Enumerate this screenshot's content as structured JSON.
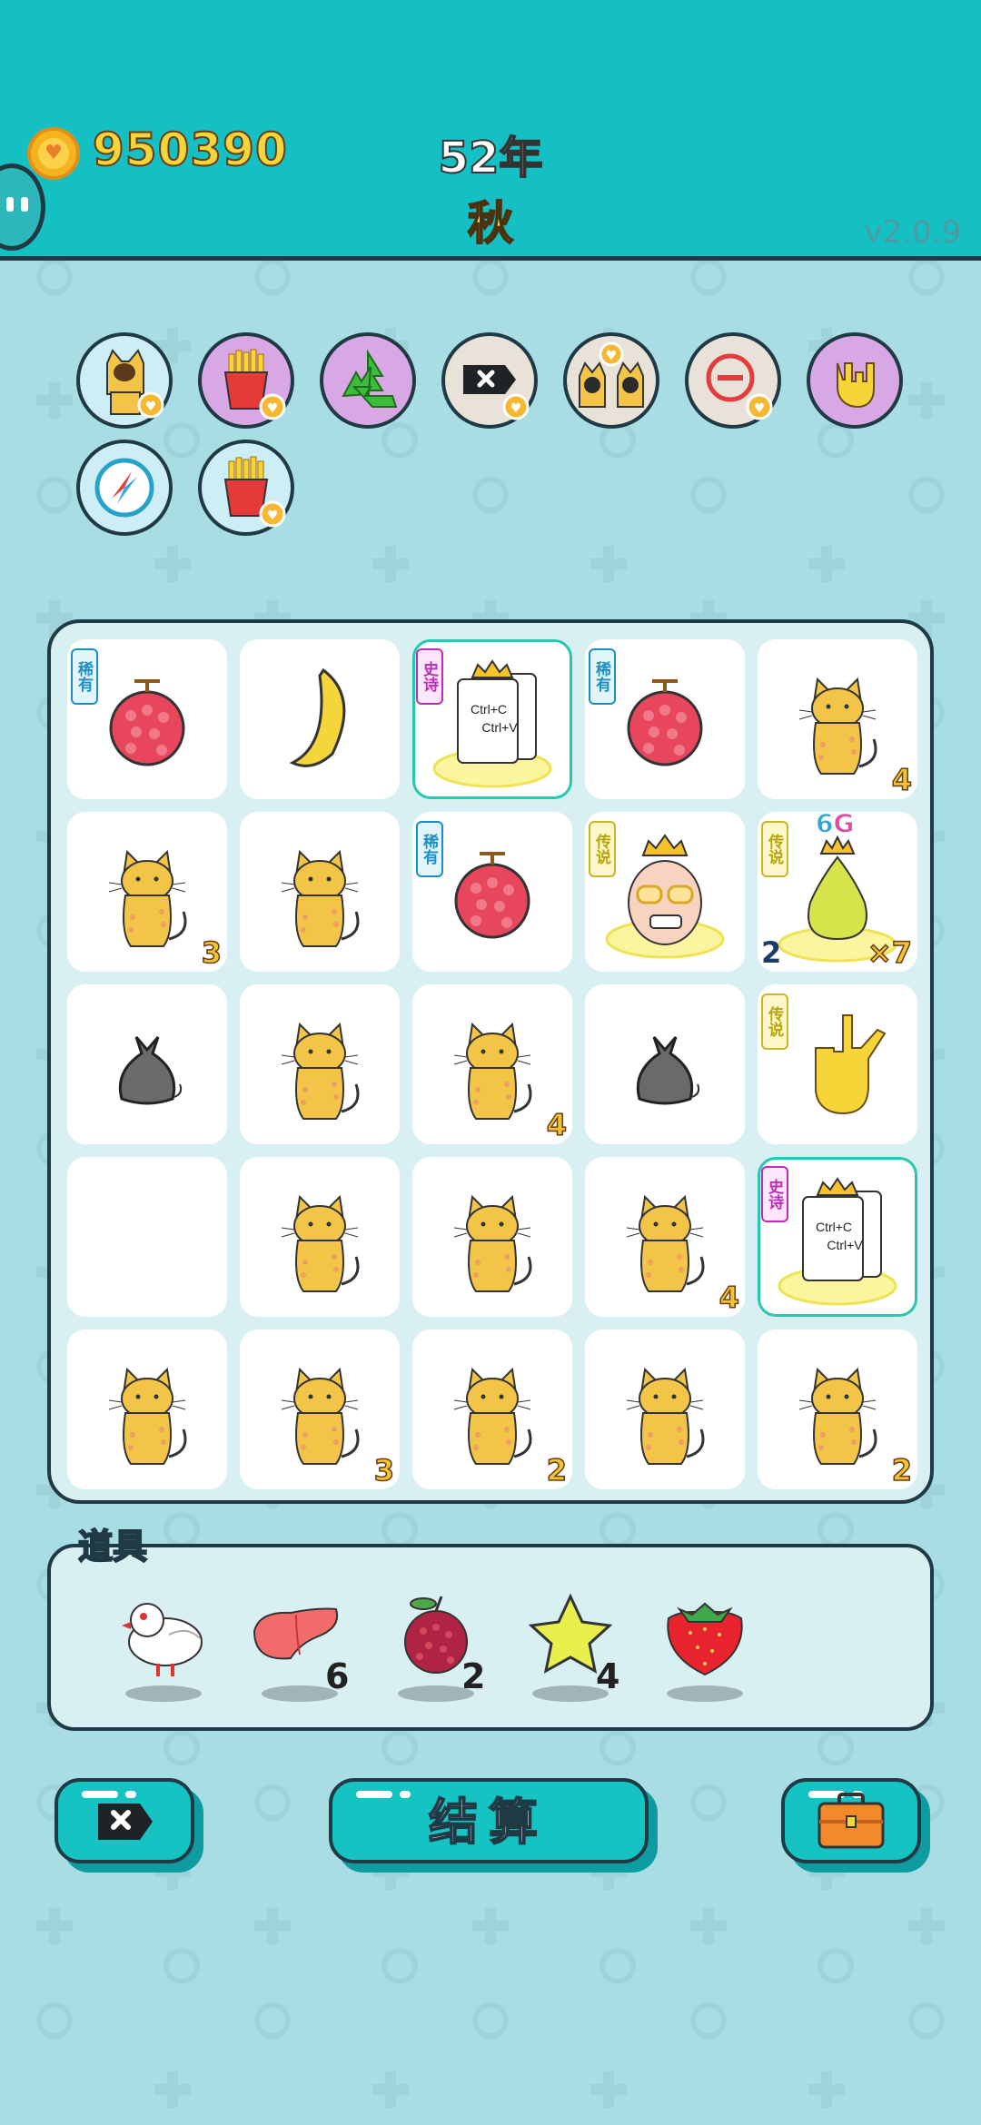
{
  "header": {
    "coins": "950390",
    "year": "52年",
    "season": "秋",
    "version": "v2.0.9"
  },
  "perks": [
    "cat-eating-icon",
    "fries-icon",
    "recycle-icon",
    "remove-tag-icon",
    "cat-glasses-icon",
    "minus-circle-icon",
    "rock-hand-icon",
    "compass-icon",
    "fries-icon"
  ],
  "board": {
    "rows": [
      [
        {
          "symbol": "lychee",
          "tag": "稀有",
          "tag_type": "rare"
        },
        {
          "symbol": "banana"
        },
        {
          "symbol": "ctrl-cv",
          "tag": "史诗",
          "tag_type": "epic",
          "highlight": true
        },
        {
          "symbol": "lychee",
          "tag": "稀有",
          "tag_type": "rare"
        },
        {
          "symbol": "cat",
          "count": "4"
        }
      ],
      [
        {
          "symbol": "cat",
          "count": "3"
        },
        {
          "symbol": "cat"
        },
        {
          "symbol": "lychee",
          "tag": "稀有",
          "tag_type": "rare"
        },
        {
          "symbol": "bald-king",
          "tag": "传说",
          "tag_type": "legend"
        },
        {
          "symbol": "pear-king",
          "tag": "传说",
          "tag_type": "legend",
          "count": "×7",
          "count_left": "2",
          "top_a": "6",
          "top_b": "G"
        }
      ],
      [
        {
          "symbol": "trash-bag"
        },
        {
          "symbol": "cat"
        },
        {
          "symbol": "cat",
          "count": "4"
        },
        {
          "symbol": "trash-bag"
        },
        {
          "symbol": "rock-hand",
          "tag": "传说",
          "tag_type": "legend"
        }
      ],
      [
        {
          "symbol": "empty"
        },
        {
          "symbol": "cat"
        },
        {
          "symbol": "cat"
        },
        {
          "symbol": "cat",
          "count": "4"
        },
        {
          "symbol": "ctrl-cv",
          "tag": "史诗",
          "tag_type": "epic",
          "highlight": true
        }
      ],
      [
        {
          "symbol": "cat"
        },
        {
          "symbol": "cat",
          "count": "3"
        },
        {
          "symbol": "cat",
          "count": "2"
        },
        {
          "symbol": "cat"
        },
        {
          "symbol": "cat",
          "count": "2"
        }
      ]
    ],
    "ctrl_c": "Ctrl+C",
    "ctrl_v": "Ctrl+V"
  },
  "items": {
    "title": "道具",
    "list": [
      {
        "name": "dove-icon",
        "count": ""
      },
      {
        "name": "liver-icon",
        "count": "6"
      },
      {
        "name": "bayberry-icon",
        "count": "2"
      },
      {
        "name": "star-icon",
        "count": "4"
      },
      {
        "name": "strawberry-icon",
        "count": ""
      }
    ]
  },
  "buttons": {
    "settle": "结算"
  },
  "colors": {
    "header": "#14c0c3",
    "background": "#a9dde4",
    "outline": "#1f3a44",
    "coin_text": "#f4d63a"
  }
}
